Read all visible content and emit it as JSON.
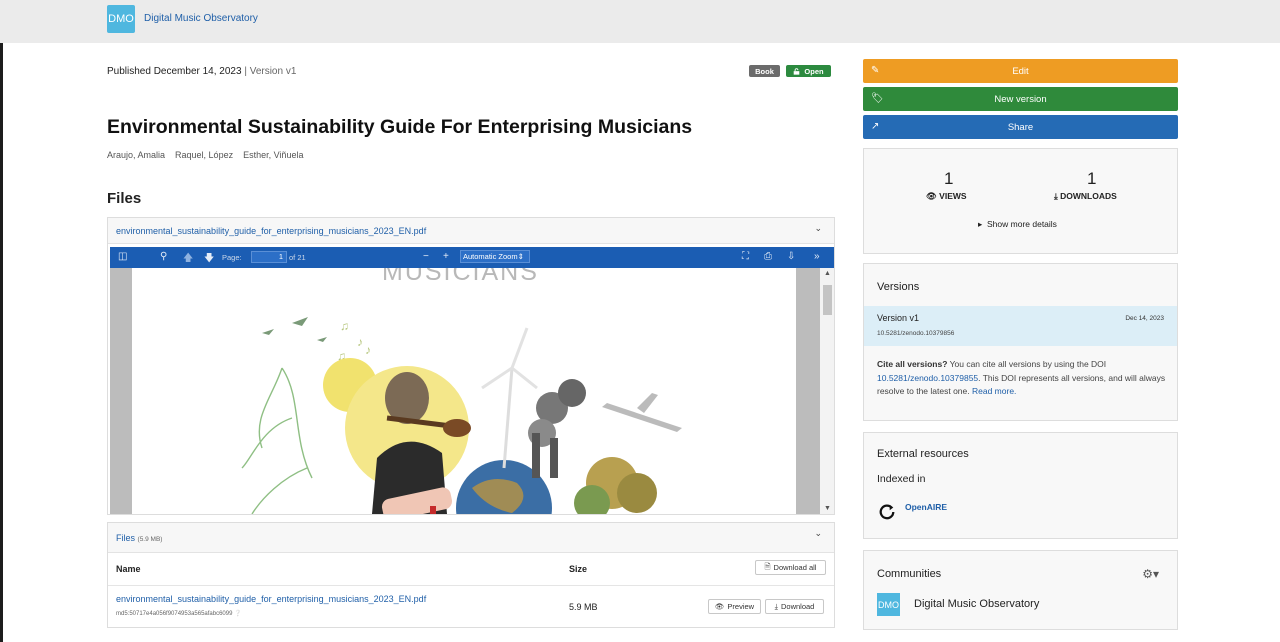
{
  "header": {
    "logo_text": "DMO",
    "site_name": "Digital Music Observatory"
  },
  "record": {
    "published_label": "Published",
    "published_date": "December 14, 2023",
    "version_label": "| Version v1",
    "badges": {
      "type": "Book",
      "access": "Open"
    },
    "title": "Environmental Sustainability Guide For Enterprising Musicians",
    "authors": [
      "Araujo, Amalia",
      "Raquel, López",
      "Esther, Viñuela"
    ],
    "files_heading": "Files"
  },
  "preview": {
    "filename": "environmental_sustainability_guide_for_enterprising_musicians_2023_EN.pdf",
    "toolbar": {
      "page_label": "Page:",
      "page_value": "1",
      "page_total": "of 21",
      "zoom": "Automatic Zoom"
    },
    "page_heading": "MUSICIANS"
  },
  "files_table": {
    "label": "Files",
    "total_size": "(5.9 MB)",
    "columns": [
      "Name",
      "Size"
    ],
    "download_all": "Download all",
    "rows": [
      {
        "name": "environmental_sustainability_guide_for_enterprising_musicians_2023_EN.pdf",
        "md5": "md5:50717e4a056f9074953a565afabc6099",
        "size": "5.9 MB",
        "preview_label": "Preview",
        "download_label": "Download"
      }
    ]
  },
  "sidebar": {
    "edit": "Edit",
    "new_version": "New version",
    "share": "Share",
    "stats": {
      "views": "1",
      "views_label": "VIEWS",
      "downloads": "1",
      "downloads_label": "DOWNLOADS",
      "more": "Show more details"
    },
    "versions": {
      "title": "Versions",
      "current_name": "Version v1",
      "current_date": "Dec 14, 2023",
      "current_doi": "10.5281/zenodo.10379856",
      "cite_bold": "Cite all versions?",
      "cite_text": "You can cite all versions by using the DOI",
      "cite_doi": "10.5281/zenodo.10379855",
      "cite_tail": ". This DOI represents all versions, and will always resolve to the latest one.",
      "read_more": "Read more."
    },
    "external": {
      "title": "External resources",
      "indexed_in": "Indexed in",
      "source": "OpenAIRE"
    },
    "communities": {
      "title": "Communities",
      "logo_text": "DMO",
      "name": "Digital Music Observatory"
    }
  },
  "colors": {
    "edit": "#ee9c23",
    "new_version": "#2f8a3b",
    "share": "#256bb5",
    "pdf_toolbar": "#1b5db3",
    "link": "#1f5fa8"
  }
}
